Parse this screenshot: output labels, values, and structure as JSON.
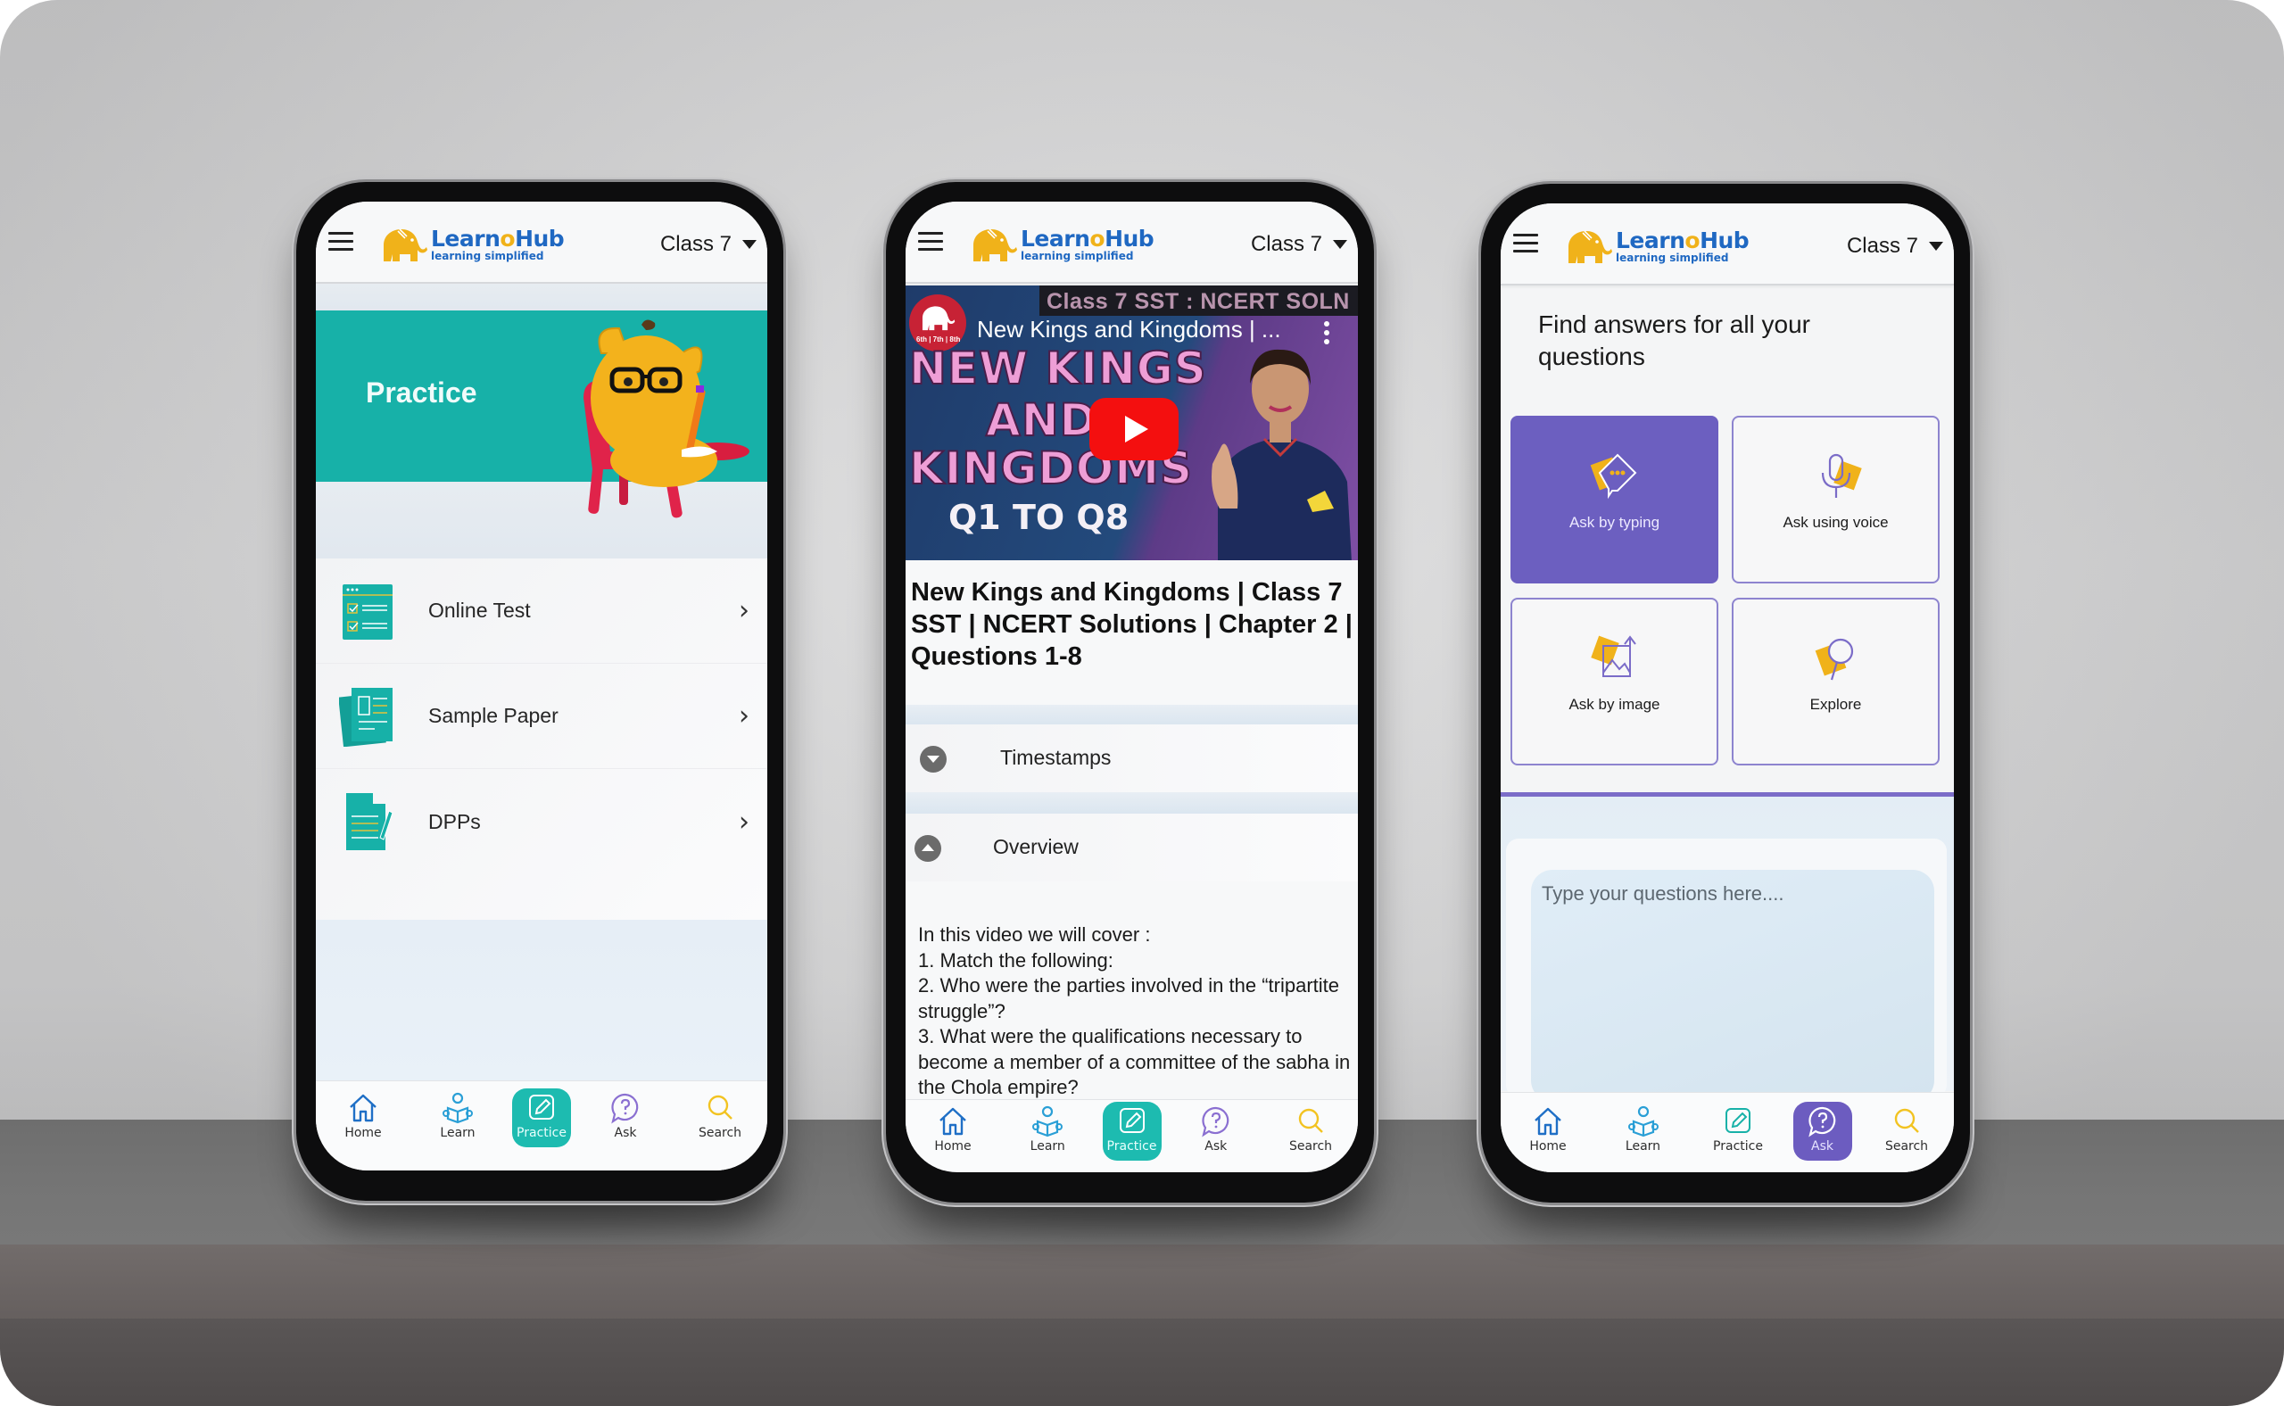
{
  "brand": {
    "name_part1": "Learn",
    "name_o": "o",
    "name_part2": "Hub",
    "tagline": "learning simplified",
    "primary_color": "#1f68c2",
    "accent_yellow": "#f0b21a",
    "teal": "#17b1a8",
    "purple": "#6c5fc0"
  },
  "header": {
    "class_selector": "Class 7"
  },
  "bottom_nav": {
    "items": [
      {
        "label": "Home",
        "icon": "home-icon"
      },
      {
        "label": "Learn",
        "icon": "learn-icon"
      },
      {
        "label": "Practice",
        "icon": "practice-icon"
      },
      {
        "label": "Ask",
        "icon": "ask-icon"
      },
      {
        "label": "Search",
        "icon": "search-icon"
      }
    ]
  },
  "phone_practice": {
    "active_tab": "Practice",
    "banner_title": "Practice",
    "items": [
      {
        "label": "Online Test",
        "icon": "online-test-icon"
      },
      {
        "label": "Sample Paper",
        "icon": "sample-paper-icon"
      },
      {
        "label": "DPPs",
        "icon": "dpp-icon"
      }
    ]
  },
  "phone_video": {
    "active_tab": "Practice",
    "video": {
      "strip_text": "Class 7 SST : NCERT SOLN",
      "overlay_title": "New Kings and Kingdoms | ...",
      "channel_badge": "6th | 7th | 8th",
      "thumb_line1": "NEW KINGS",
      "thumb_line2": "AND",
      "thumb_line3": "KINGDOMS",
      "thumb_line4": "Q1 TO Q8"
    },
    "title": "New Kings and Kingdoms | Class 7 SST | NCERT Solutions | Chapter 2 | Questions 1-8",
    "sections": [
      {
        "label": "Timestamps",
        "state": "collapsed"
      },
      {
        "label": "Overview",
        "state": "expanded"
      }
    ],
    "overview_text": "In this video we will cover :\n1. Match the following:\n2. Who were the parties involved in the “tripartite struggle”?\n3. What were the qualifications necessary to become a member of a committee of the sabha in the Chola empire?"
  },
  "phone_ask": {
    "active_tab": "Ask",
    "heading": "Find answers for all your questions",
    "options": [
      {
        "label": "Ask by typing",
        "icon": "chat-typing-icon",
        "selected": true
      },
      {
        "label": "Ask using voice",
        "icon": "microphone-icon",
        "selected": false
      },
      {
        "label": "Ask by image",
        "icon": "image-upload-icon",
        "selected": false
      },
      {
        "label": "Explore",
        "icon": "explore-icon",
        "selected": false
      }
    ],
    "input_placeholder": "Type your questions here...."
  }
}
